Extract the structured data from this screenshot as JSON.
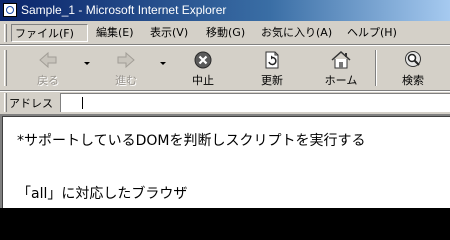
{
  "window": {
    "title": "Sample_1 - Microsoft Internet Explorer"
  },
  "menu": {
    "items": [
      {
        "label": "ファイル(F)"
      },
      {
        "label": "編集(E)"
      },
      {
        "label": "表示(V)"
      },
      {
        "label": "移動(G)"
      },
      {
        "label": "お気に入り(A)"
      },
      {
        "label": "ヘルプ(H)"
      }
    ]
  },
  "toolbar": {
    "back": {
      "label": "戻る",
      "icon": "back-arrow-icon",
      "enabled": false
    },
    "forward": {
      "label": "進む",
      "icon": "forward-arrow-icon",
      "enabled": false
    },
    "stop": {
      "label": "中止",
      "icon": "stop-icon"
    },
    "refresh": {
      "label": "更新",
      "icon": "refresh-icon"
    },
    "home": {
      "label": "ホーム",
      "icon": "home-icon"
    },
    "search": {
      "label": "検索",
      "icon": "search-icon"
    }
  },
  "address": {
    "label": "アドレス",
    "value": ""
  },
  "content": {
    "line1": "*サポートしているDOMを判断しスクリプトを実行する",
    "line2": "「all」に対応したブラウザ"
  },
  "colors": {
    "title_bar_start": "#0a246a",
    "title_bar_end": "#a6caf0",
    "chrome": "#d4d0c8"
  }
}
